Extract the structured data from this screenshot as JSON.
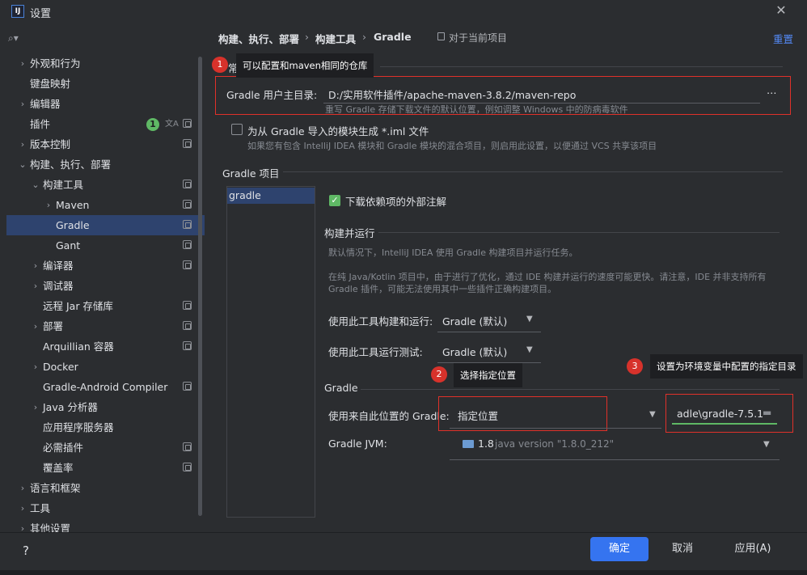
{
  "window": {
    "title": "设置",
    "logo_text": "IJ"
  },
  "sidebar": {
    "search_placeholder": "",
    "items": [
      {
        "label": "外观和行为",
        "chev": "›"
      },
      {
        "label": "键盘映射",
        "chev": ""
      },
      {
        "label": "编辑器",
        "chev": "›"
      },
      {
        "label": "插件",
        "chev": "",
        "badge": "1"
      },
      {
        "label": "版本控制",
        "chev": "›"
      },
      {
        "label": "构建、执行、部署",
        "chev": "⌄"
      },
      {
        "label": "构建工具",
        "chev": "⌄"
      },
      {
        "label": "Maven",
        "chev": "›"
      },
      {
        "label": "Gradle",
        "chev": ""
      },
      {
        "label": "Gant",
        "chev": ""
      },
      {
        "label": "编译器",
        "chev": "›"
      },
      {
        "label": "调试器",
        "chev": "›"
      },
      {
        "label": "远程 Jar 存储库",
        "chev": ""
      },
      {
        "label": "部署",
        "chev": "›"
      },
      {
        "label": "Arquillian 容器",
        "chev": ""
      },
      {
        "label": "Docker",
        "chev": "›"
      },
      {
        "label": "Gradle-Android Compiler",
        "chev": ""
      },
      {
        "label": "Java 分析器",
        "chev": "›"
      },
      {
        "label": "应用程序服务器",
        "chev": ""
      },
      {
        "label": "必需插件",
        "chev": ""
      },
      {
        "label": "覆盖率",
        "chev": ""
      },
      {
        "label": "语言和框架",
        "chev": "›"
      },
      {
        "label": "工具",
        "chev": "›"
      },
      {
        "label": "其他设置",
        "chev": "›"
      }
    ]
  },
  "breadcrumb": {
    "part1": "构建、执行、部署",
    "part2": "构建工具",
    "part3": "Gradle",
    "sep": "›",
    "scope": "对于当前项目",
    "reset": "重置"
  },
  "general": {
    "section_label": "常规",
    "user_home_label": "Gradle 用户主目录:",
    "user_home_value": "D:/实用软件插件/apache-maven-3.8.2/maven-repo",
    "browse": "…",
    "user_home_hint": "重写 Gradle 存储下载文件的默认位置，例如调整 Windows 中的防病毒软件",
    "iml_label": "为从 Gradle 导入的模块生成 *.iml 文件",
    "iml_hint": "如果您有包含 IntelliJ IDEA 模块和 Gradle 模块的混合项目，则启用此设置，以便通过 VCS 共享该项目"
  },
  "projects": {
    "section_label": "Gradle 项目",
    "items": [
      "gradle"
    ],
    "download_annotations": "下载依赖项的外部注解",
    "build_run_label": "构建并运行",
    "build_hint1": "默认情况下，IntelliJ IDEA 使用 Gradle 构建项目并运行任务。",
    "build_hint2": "在纯 Java/Kotlin 项目中，由于进行了优化，通过 IDE 构建并运行的速度可能更快。请注意，IDE 并非支持所有",
    "build_hint3": "Gradle 插件，可能无法使用其中一些插件正确构建项目。",
    "build_with_label": "使用此工具构建和运行:",
    "build_with_value": "Gradle (默认)",
    "test_with_label": "使用此工具运行测试:",
    "test_with_value": "Gradle (默认)",
    "gradle_label": "Gradle",
    "use_gradle_from_label": "使用来自此位置的 Gradle:",
    "use_gradle_from_value": "指定位置",
    "gradle_path_value": "adle\\gradle-7.5.1",
    "jvm_label": "Gradle JVM:",
    "jvm_version": "1.8",
    "jvm_desc": "java version \"1.8.0_212\""
  },
  "annotations": {
    "c1_num": "1",
    "c1_text": "可以配置和maven相同的仓库",
    "c2_num": "2",
    "c2_text": "选择指定位置",
    "c3_num": "3",
    "c3_text": "设置为环境变量中配置的指定目录"
  },
  "footer": {
    "help": "?",
    "ok": "确定",
    "cancel": "取消",
    "apply": "应用(A)"
  },
  "colors": {
    "accent": "#3574f0",
    "annotation_red": "#e0312a",
    "selection": "#2e436e",
    "check_green": "#5fb865"
  }
}
